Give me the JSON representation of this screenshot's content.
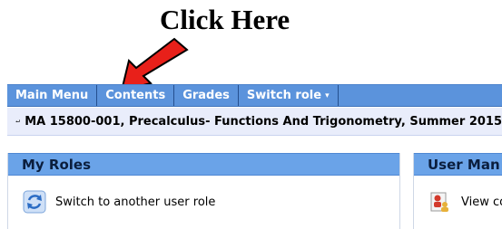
{
  "annotation": {
    "callout_text": "Click Here"
  },
  "navbar": {
    "items": [
      {
        "label": "Main Menu"
      },
      {
        "label": "Contents"
      },
      {
        "label": "Grades"
      },
      {
        "label": "Switch role",
        "caret": "▾"
      }
    ]
  },
  "course": {
    "title": "MA 15800-001, Precalculus- Functions And Trigonometry, Summer 2015"
  },
  "panels": {
    "my_roles": {
      "title": "My Roles",
      "item_label": "Switch to another user role",
      "item_icon": "refresh-icon"
    },
    "user_management": {
      "title": "User Man",
      "item_label": "View co",
      "item_icon": "users-icon"
    }
  },
  "colors": {
    "nav_bg": "#5b93dc",
    "course_bar_bg": "#e9edfb",
    "panel_header_bg": "#6aa3e8",
    "arrow": "#e8201a"
  }
}
